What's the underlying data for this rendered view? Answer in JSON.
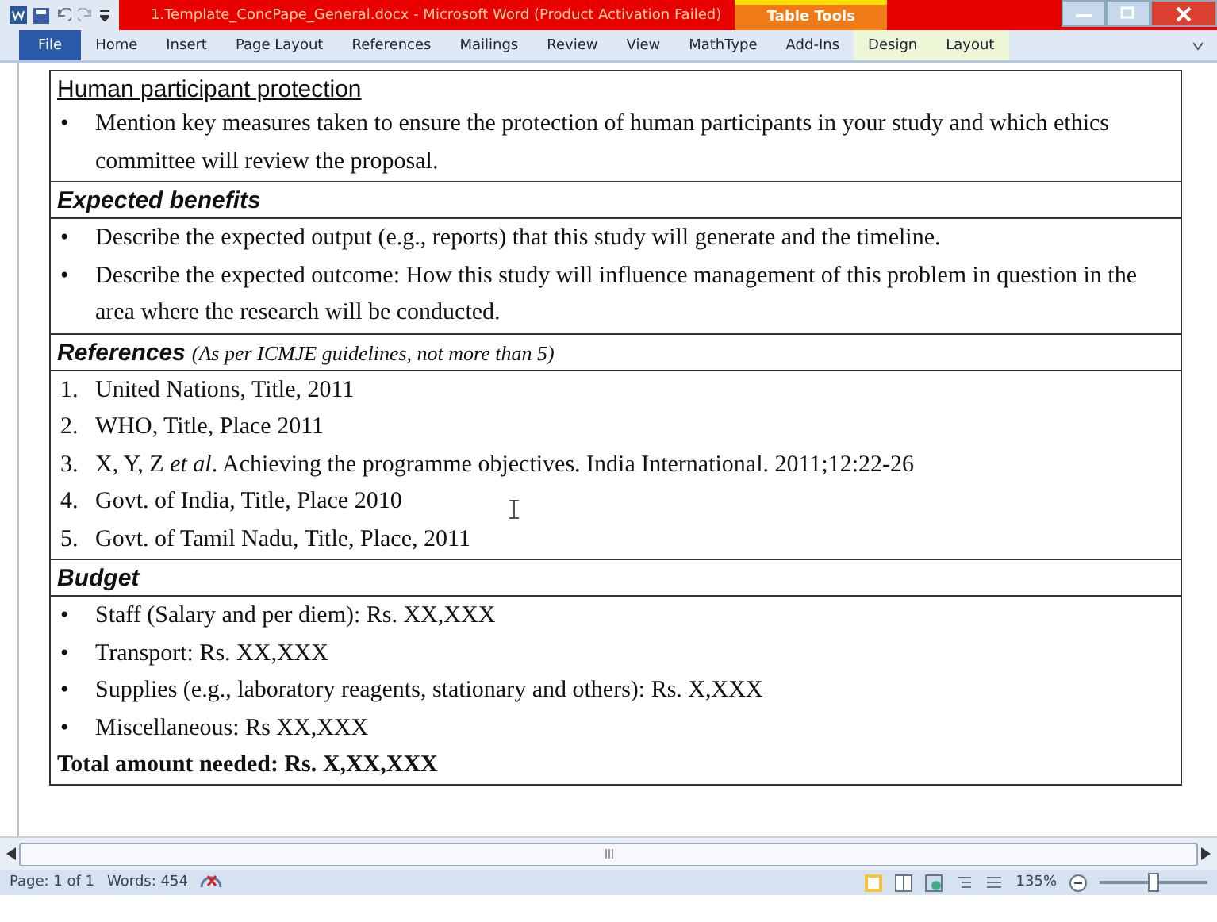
{
  "window": {
    "title": "1.Template_ConcPape_General.docx - Microsoft Word (Product Activation Failed)",
    "context_label": "Table Tools"
  },
  "tabs": [
    {
      "label": "File",
      "selected": true,
      "contextual": false
    },
    {
      "label": "Home",
      "selected": false,
      "contextual": false
    },
    {
      "label": "Insert",
      "selected": false,
      "contextual": false
    },
    {
      "label": "Page Layout",
      "selected": false,
      "contextual": false
    },
    {
      "label": "References",
      "selected": false,
      "contextual": false
    },
    {
      "label": "Mailings",
      "selected": false,
      "contextual": false
    },
    {
      "label": "Review",
      "selected": false,
      "contextual": false
    },
    {
      "label": "View",
      "selected": false,
      "contextual": false
    },
    {
      "label": "MathType",
      "selected": false,
      "contextual": false
    },
    {
      "label": "Add-Ins",
      "selected": false,
      "contextual": false
    },
    {
      "label": "Design",
      "selected": false,
      "contextual": true
    },
    {
      "label": "Layout",
      "selected": false,
      "contextual": true
    }
  ],
  "document": {
    "sections": [
      {
        "heading": "Human participant protection",
        "kind": "inline",
        "items": [
          {
            "kind": "bullet",
            "marker": "•",
            "text": "Mention key measures taken to ensure the protection of human participants in your study and which ethics committee will review the proposal."
          }
        ]
      },
      {
        "heading": "Expected benefits",
        "kind": "titled",
        "items": [
          {
            "kind": "bullet",
            "marker": "•",
            "text": "Describe the expected output (e.g., reports) that this study will generate and the timeline."
          },
          {
            "kind": "bullet",
            "marker": "•",
            "text": "Describe the expected outcome: How this study will influence management of this problem in question in the area where the research will be conducted."
          }
        ]
      },
      {
        "heading": "References",
        "note": "(As per ICMJE guidelines, not more than 5)",
        "kind": "titled",
        "items": [
          {
            "kind": "numbered",
            "marker": "1.",
            "text": "United Nations, Title, 2011"
          },
          {
            "kind": "numbered",
            "marker": "2.",
            "text": "WHO, Title, Place 2011"
          },
          {
            "kind": "numbered",
            "marker": "3.",
            "text": "X, Y, Z *et al*. Achieving the programme objectives. India International. 2011;12:22-26"
          },
          {
            "kind": "numbered",
            "marker": "4.",
            "text": "Govt. of India, Title, Place 2010"
          },
          {
            "kind": "numbered",
            "marker": "5.",
            "text": "Govt. of Tamil Nadu, Title, Place, 2011"
          }
        ]
      },
      {
        "heading": "Budget",
        "kind": "titled",
        "items": [
          {
            "kind": "bullet",
            "marker": "•",
            "text": "Staff (Salary and per diem): Rs. XX,XXX"
          },
          {
            "kind": "bullet",
            "marker": "•",
            "text": "Transport: Rs. XX,XXX"
          },
          {
            "kind": "bullet",
            "marker": "•",
            "text": "Supplies (e.g., laboratory reagents, stationary and others): Rs. X,XXX"
          },
          {
            "kind": "bullet",
            "marker": "•",
            "text": "Miscellaneous:  Rs XX,XXX"
          },
          {
            "kind": "total",
            "text": "Total amount needed: Rs. X,XX,XXX"
          }
        ]
      }
    ]
  },
  "status_bar": {
    "page": "Page: 1 of 1",
    "words": "Words: 454",
    "zoom": "135%",
    "zoom_level": {
      "level": 0.5
    }
  }
}
